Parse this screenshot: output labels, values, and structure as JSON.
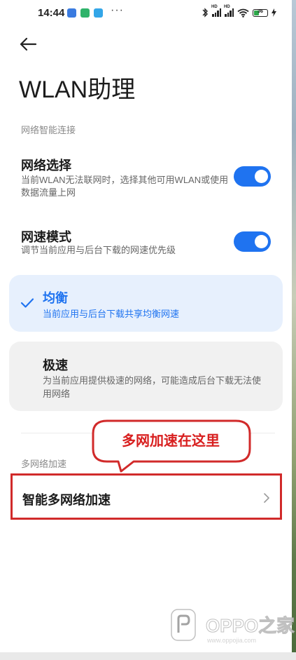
{
  "status_bar": {
    "time": "14:44",
    "overflow": "···",
    "battery": "36",
    "icons": [
      "bluetooth-icon",
      "signal-icon",
      "signal-icon",
      "wifi-icon",
      "battery-icon",
      "charging-icon"
    ]
  },
  "header": {
    "back_icon": "arrow-left-icon",
    "title": "WLAN助理"
  },
  "smart_connection": {
    "section_label": "网络智能连接",
    "network_select": {
      "title": "网络选择",
      "desc": "当前WLAN无法联网时，选择其他可用WLAN或使用数据流量上网",
      "enabled": true
    },
    "speed_mode": {
      "title": "网速模式",
      "desc": "调节当前应用与后台下载的网速优先级",
      "enabled": true
    },
    "options": [
      {
        "title": "均衡",
        "desc": "当前应用与后台下载共享均衡网速",
        "selected": true
      },
      {
        "title": "极速",
        "desc": "为当前应用提供极速的网络，可能造成后台下载无法使用网络",
        "selected": false
      }
    ]
  },
  "annotation": {
    "text": "多网加速在这里",
    "color": "#d81f1f"
  },
  "multi_network": {
    "section_label": "多网络加速",
    "item": "智能多网络加速"
  },
  "watermark": {
    "text": "OPPO之家",
    "url": "www.oppojia.com"
  },
  "colors": {
    "accent": "#1f73f0",
    "selected_card": "#e7f0fd",
    "card": "#f1f1f1",
    "highlight_border": "#d12a2a"
  }
}
